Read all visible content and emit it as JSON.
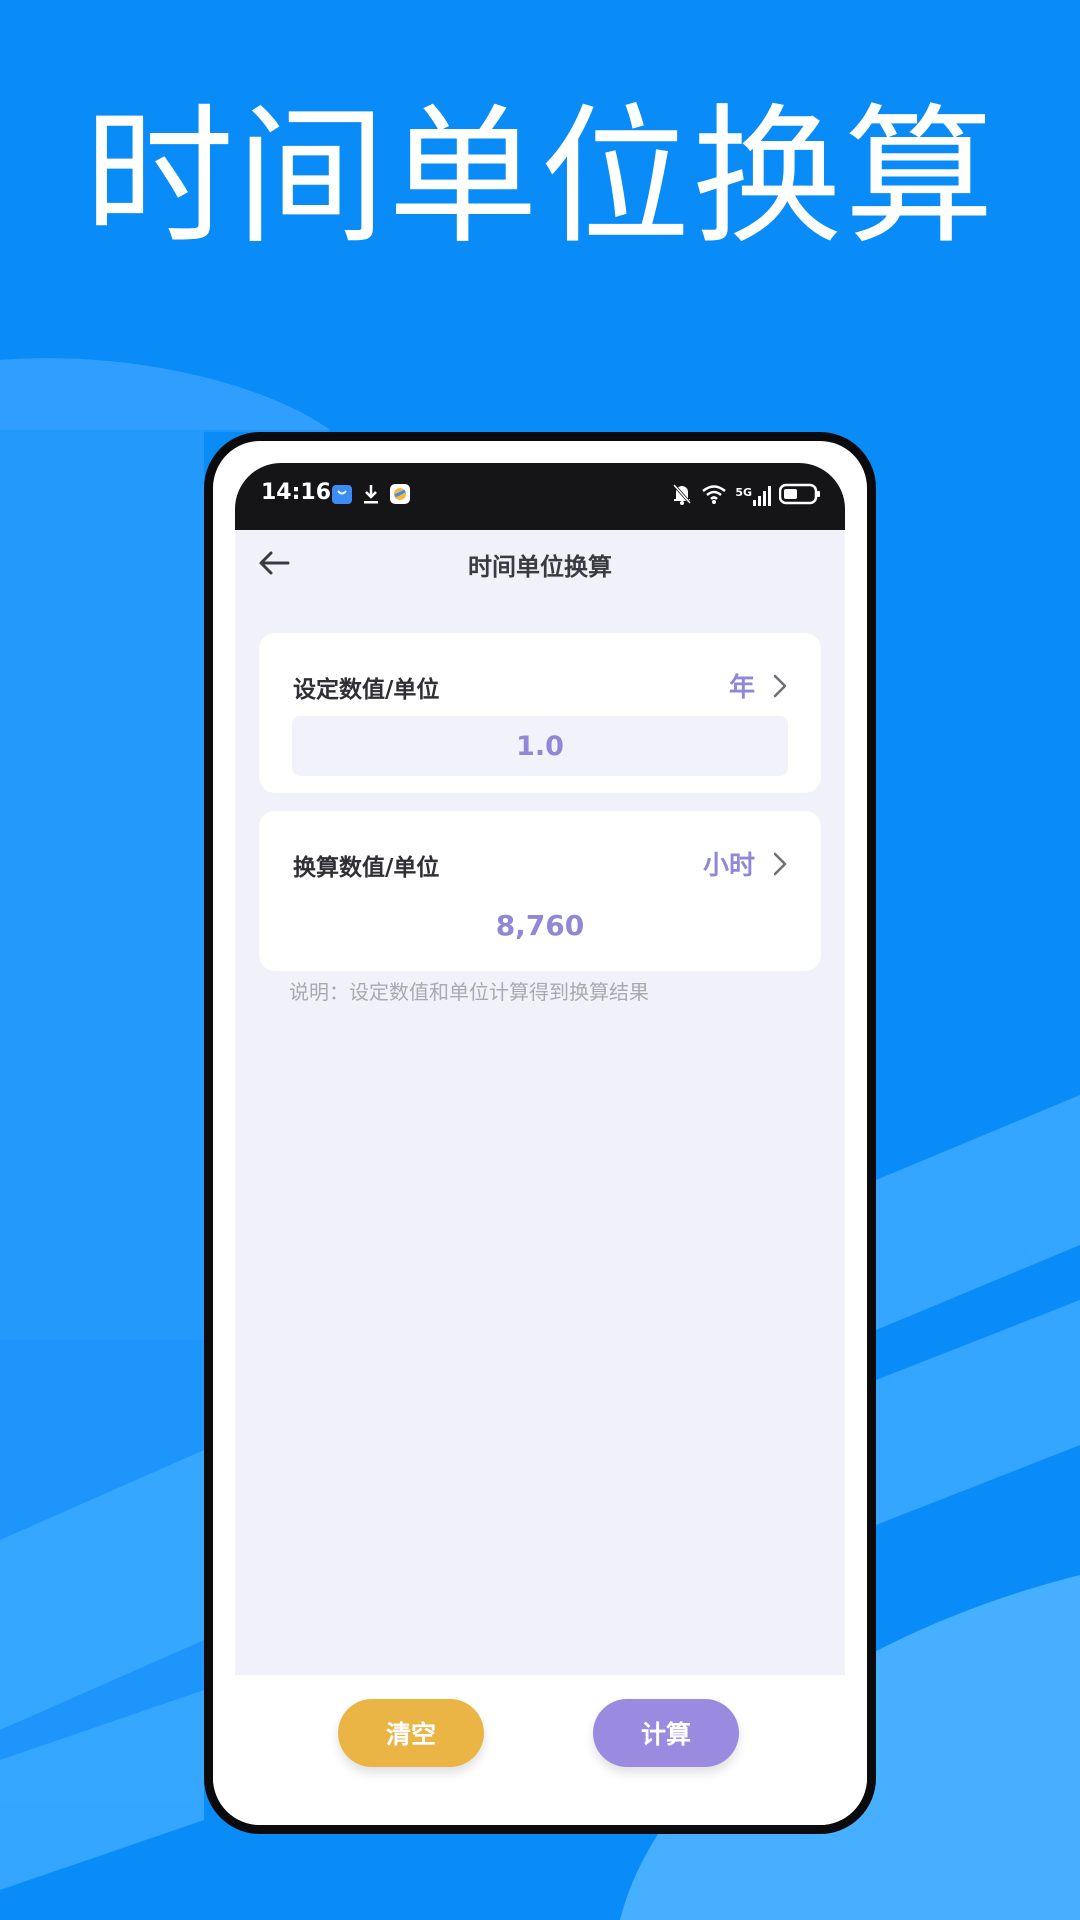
{
  "hero": {
    "title": "时间单位换算"
  },
  "status_bar": {
    "time": "14:16",
    "network": "5G"
  },
  "header": {
    "title": "时间单位换算"
  },
  "source_card": {
    "label": "设定数值/单位",
    "unit": "年",
    "value": "1.0"
  },
  "result_card": {
    "label": "换算数值/单位",
    "unit": "小时",
    "value": "8,760"
  },
  "note": "说明：设定数值和单位计算得到换算结果",
  "buttons": {
    "clear_label": "清空",
    "calc_label": "计算"
  },
  "colors": {
    "background": "#0a8cf8",
    "accent": "#9187d7",
    "clear_button": "#ebb546",
    "calc_button": "#9b8be0"
  },
  "icons": [
    "back-arrow-icon",
    "chevron-right-icon",
    "app-store-icon",
    "download-icon",
    "browser-icon",
    "bell-off-icon",
    "wifi-icon",
    "signal-icon",
    "battery-icon"
  ]
}
